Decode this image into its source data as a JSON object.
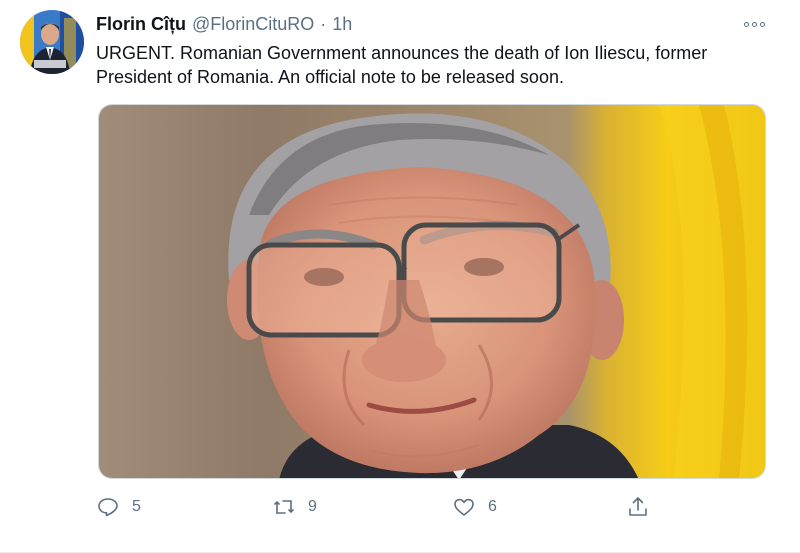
{
  "tweet": {
    "author_name": "Florin Cîțu",
    "author_handle": "@FlorinCituRO",
    "separator": "·",
    "time": "1h",
    "text_line1": "URGENT. Romanian Government announces the death of Ion Iliescu, former",
    "text_line2": "President of Romania. An official note to be released soon.",
    "reply_count": "5",
    "retweet_count": "9",
    "like_count": "6"
  },
  "icons": {
    "more": "more-options-icon",
    "reply": "reply-icon",
    "retweet": "retweet-icon",
    "like": "heart-icon",
    "share": "share-icon"
  },
  "colors": {
    "text_primary": "#0f1419",
    "text_secondary": "#5b7083",
    "border": "#cfd9de",
    "flag_yellow": "#f4c20d"
  }
}
